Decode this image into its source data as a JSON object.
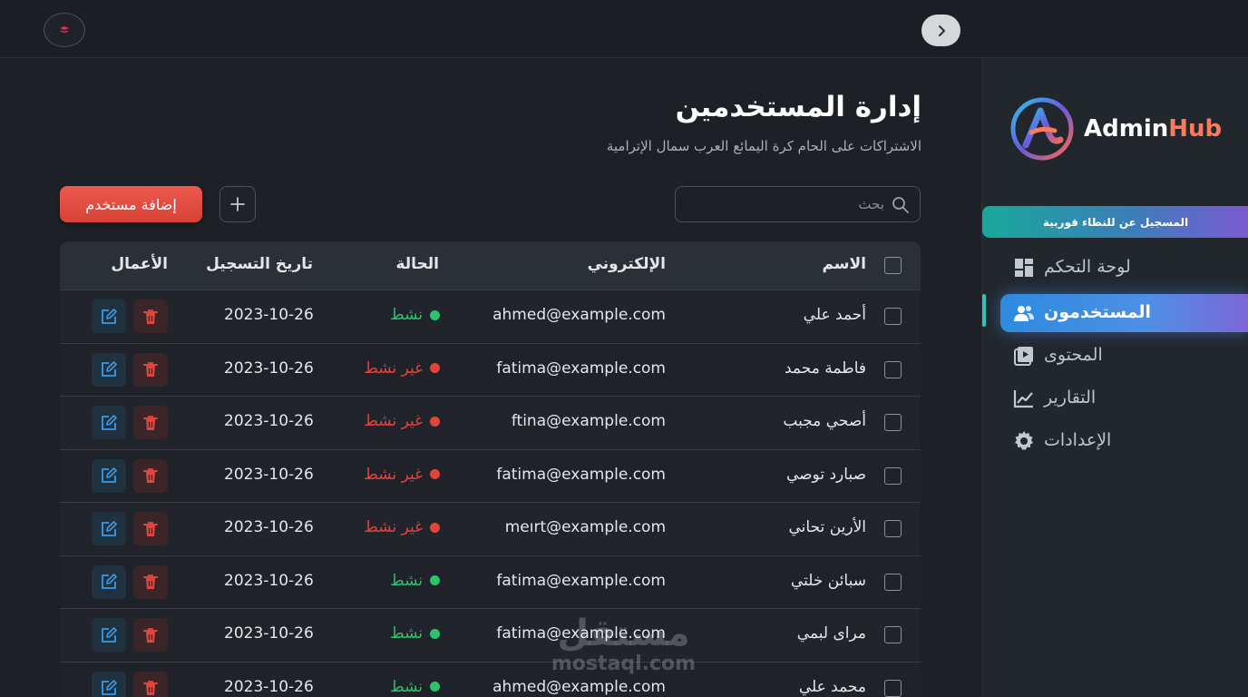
{
  "brand": {
    "name_part1": "Admin",
    "name_part2": "Hub"
  },
  "sidebar": {
    "promo": "المسجيل عن للنطاء قوربية",
    "items": [
      {
        "label": "لوحة التحكم",
        "icon": "dashboard-icon",
        "active": false
      },
      {
        "label": "المستخدمون",
        "icon": "users-icon",
        "active": true
      },
      {
        "label": "المحتوى",
        "icon": "content-icon",
        "active": false
      },
      {
        "label": "التقارير",
        "icon": "reports-icon",
        "active": false
      },
      {
        "label": "الإعدادات",
        "icon": "settings-icon",
        "active": false
      }
    ]
  },
  "main": {
    "title": "إدارة المستخدمين",
    "subtitle": "الاشتراكات على الحام كرة اليمائع العرب سمال الإترامية",
    "search_placeholder": "بحث",
    "add_user_label": "إضافة مستخدم"
  },
  "table": {
    "headers": {
      "name": "الاسم",
      "email": "الإلكتروني",
      "status": "الحالة",
      "date": "تاريخ التسجيل",
      "actions": "الأعمال"
    },
    "rows": [
      {
        "name": "أحمد علي",
        "email": "ahmed@example.com",
        "status": "نشط",
        "active": true,
        "date": "2023-10-26"
      },
      {
        "name": "فاطمة محمد",
        "email": "fatima@example.com",
        "status": "غير نشط",
        "active": false,
        "date": "2023-10-26"
      },
      {
        "name": "أصحي مجبب",
        "email": "ftina@example.com",
        "status": "غير نشط",
        "active": false,
        "date": "2023-10-26"
      },
      {
        "name": "صبارد توصي",
        "email": "fatima@example.com",
        "status": "غير نشط",
        "active": false,
        "date": "2023-10-26"
      },
      {
        "name": "الأرين تحاني",
        "email": "meırt@example.com",
        "status": "غير نشط",
        "active": false,
        "date": "2023-10-26"
      },
      {
        "name": "سبائن خلتي",
        "email": "fatima@example.com",
        "status": "نشط",
        "active": true,
        "date": "2023-10-26"
      },
      {
        "name": "مراى لبمي",
        "email": "fatima@example.com",
        "status": "نشط",
        "active": true,
        "date": "2023-10-26"
      },
      {
        "name": "محمد علي",
        "email": "ahmed@example.com",
        "status": "نشط",
        "active": true,
        "date": "2023-10-26"
      }
    ]
  },
  "watermark": {
    "arabic": "مستقل",
    "latin": "mostaql.com"
  },
  "colors": {
    "active_green": "#2ec26a",
    "inactive_red": "#e0453c",
    "accent_blue": "#3a8ee6",
    "add_button": "#e04e42"
  }
}
